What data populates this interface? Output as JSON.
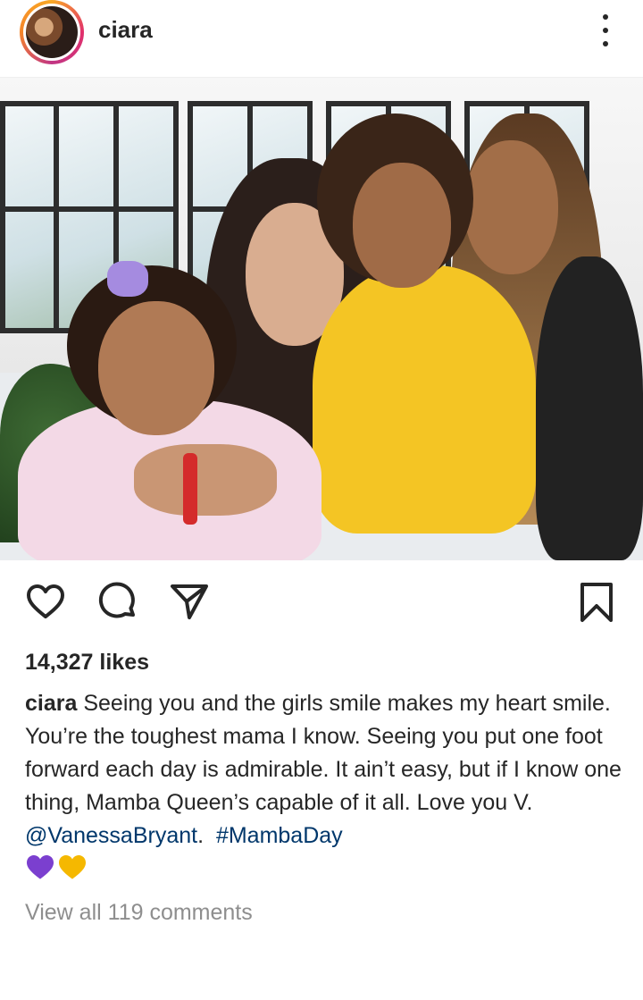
{
  "header": {
    "username": "ciara"
  },
  "post": {
    "likes": "14,327 likes",
    "caption_user": "ciara",
    "caption_text": "Seeing you and the girls smile makes my heart smile. You’re the toughest mama I know. Seeing you put one foot forward each day is admirable. It ain’t easy, but if I know one thing, Mamba Queen’s capable of it all. Love you V.",
    "mention": "@VanessaBryant",
    "separator": ".",
    "hashtag": "#MambaDay",
    "view_comments": "View all 119 comments",
    "emojis": [
      "purple-heart",
      "yellow-heart"
    ]
  },
  "colors": {
    "text": "#262626",
    "link": "#00376b",
    "muted": "#8e8e8e",
    "purple_heart": "#7b3fcf",
    "yellow_heart": "#f5b800"
  },
  "icons": {
    "like": "heart-icon",
    "comment": "comment-icon",
    "share": "send-icon",
    "save": "bookmark-icon",
    "more": "more-options-icon"
  }
}
